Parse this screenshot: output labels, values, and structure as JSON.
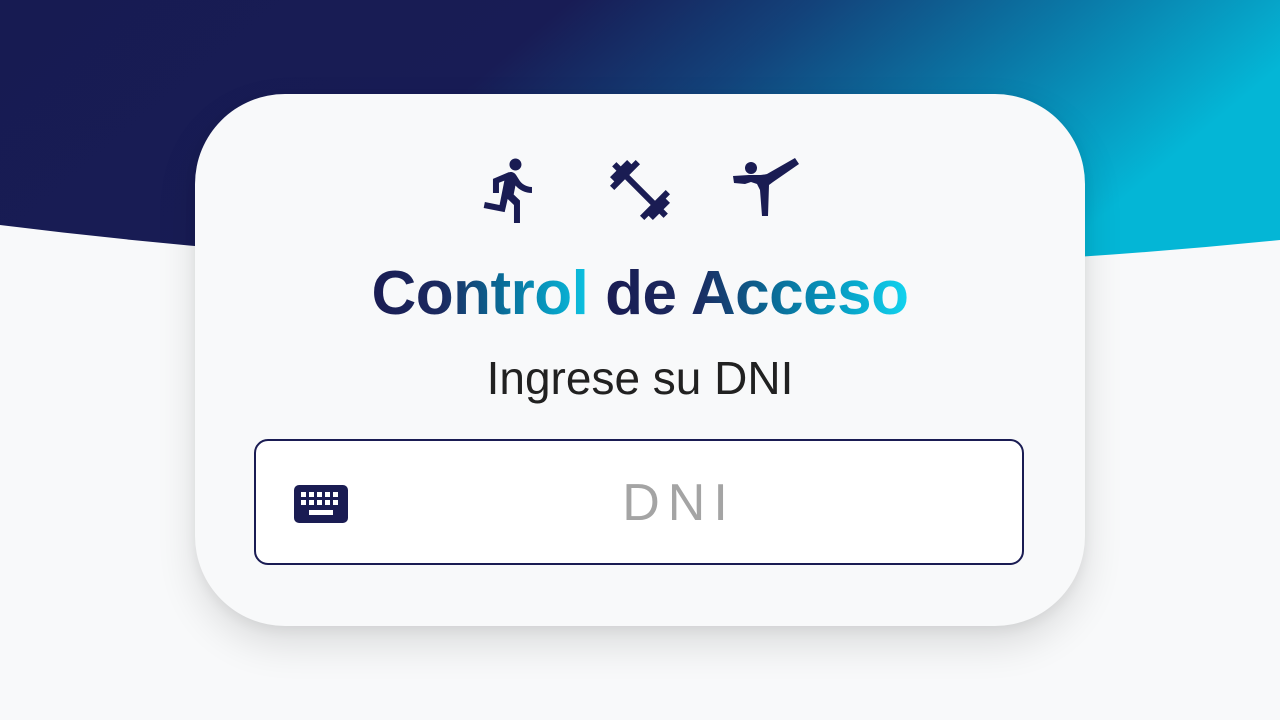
{
  "header": {
    "title_part1": "Control ",
    "title_part2": "de Acceso",
    "subtitle": "Ingrese su DNI"
  },
  "icons": [
    "running-icon",
    "dumbbell-icon",
    "martial-arts-icon",
    "keyboard-icon"
  ],
  "form": {
    "dni_placeholder": "DNI",
    "dni_value": ""
  },
  "colors": {
    "primary_dark": "#1a1c53",
    "accent_cyan": "#12d3ef",
    "background": "#f8f9fa"
  }
}
